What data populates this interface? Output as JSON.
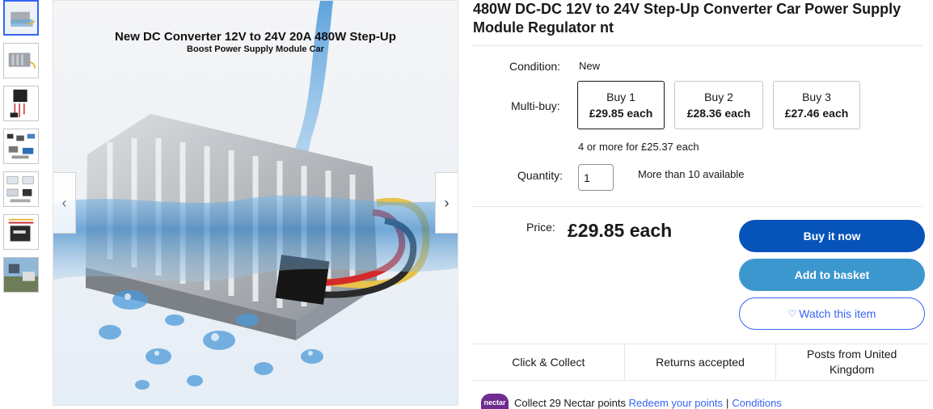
{
  "gallery": {
    "thumbnails": [
      {
        "name": "thumbnail-1",
        "selected": true
      },
      {
        "name": "thumbnail-2",
        "selected": false
      },
      {
        "name": "thumbnail-3",
        "selected": false
      },
      {
        "name": "thumbnail-4",
        "selected": false
      },
      {
        "name": "thumbnail-5",
        "selected": false
      },
      {
        "name": "thumbnail-6",
        "selected": false
      },
      {
        "name": "thumbnail-7",
        "selected": false
      }
    ],
    "main_image": {
      "caption_line1": "New DC Converter 12V to 24V 20A 480W Step-Up",
      "caption_line2": "Boost Power Supply Module Car"
    },
    "prev_icon": "chevron-left-icon",
    "next_icon": "chevron-right-icon"
  },
  "listing": {
    "title": "480W DC-DC 12V to 24V Step-Up Converter Car Power Supply Module Regulator nt",
    "condition_label": "Condition:",
    "condition_value": "New",
    "multibuy_label": "Multi-buy:",
    "multibuy": [
      {
        "qty": "Buy 1",
        "price": "£29.85 each",
        "selected": true
      },
      {
        "qty": "Buy 2",
        "price": "£28.36 each",
        "selected": false
      },
      {
        "qty": "Buy 3",
        "price": "£27.46 each",
        "selected": false
      }
    ],
    "multibuy_note": "4 or more for £25.37 each",
    "quantity_label": "Quantity:",
    "quantity_value": "1",
    "availability": "More than 10 available",
    "price_label": "Price:",
    "price": "£29.85 each",
    "buy_now": "Buy it now",
    "add_to_basket": "Add to basket",
    "watch": "Watch this item",
    "watch_icon": "heart-icon",
    "features": [
      "Click & Collect",
      "Returns accepted",
      "Posts from United Kingdom"
    ],
    "nectar": {
      "logo": "nectar",
      "collect": "Collect 29 Nectar points",
      "redeem": "Redeem your points",
      "separator": "|",
      "conditions": "Conditions"
    }
  },
  "colors": {
    "primary_button": "#0654ba",
    "secondary_button": "#3d97cf",
    "link": "#3665f3",
    "nectar_purple": "#6f2c91"
  }
}
